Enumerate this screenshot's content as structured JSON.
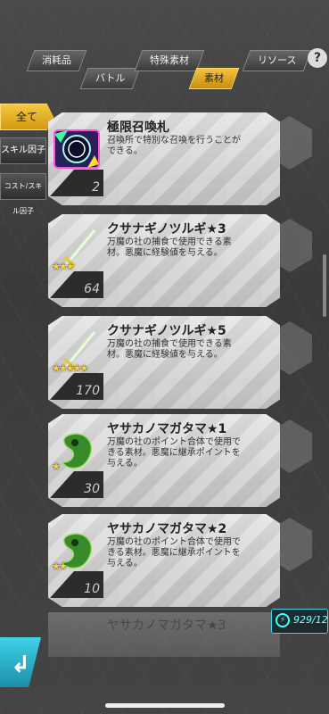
{
  "tabs": [
    {
      "label": "消耗品"
    },
    {
      "label": "バトル"
    },
    {
      "label": "特殊素材"
    },
    {
      "label": "素材"
    },
    {
      "label": "リソース"
    }
  ],
  "help_label": "?",
  "filters": [
    {
      "label": "全て"
    },
    {
      "label": "スキル因子"
    },
    {
      "label": "コスト/スキル因子"
    }
  ],
  "items": [
    {
      "name": "極限召喚札",
      "desc": "召喚所で特別な召喚を行うことができる。",
      "count": "2",
      "stars": ""
    },
    {
      "name": "クサナギノツルギ★3",
      "desc": "万魔の社の捕食で使用できる素材。悪魔に経験値を与える。",
      "count": "64",
      "stars": "★★★"
    },
    {
      "name": "クサナギノツルギ★5",
      "desc": "万魔の社の捕食で使用できる素材。悪魔に経験値を与える。",
      "count": "170",
      "stars": "★★★★★"
    },
    {
      "name": "ヤサカノマガタマ★1",
      "desc": "万魔の社のポイント合体で使用できる素材。悪魔に継承ポイントを与える。",
      "count": "30",
      "stars": "★"
    },
    {
      "name": "ヤサカノマガタマ★2",
      "desc": "万魔の社のポイント合体で使用できる素材。悪魔に継承ポイントを与える。",
      "count": "10",
      "stars": "★★"
    },
    {
      "name": "ヤサカノマガタマ★3",
      "desc": "",
      "count": "",
      "stars": ""
    }
  ],
  "capacity": "929/12",
  "colors": {
    "accent": "#f3c23a",
    "cyan": "#3fd2e8"
  }
}
